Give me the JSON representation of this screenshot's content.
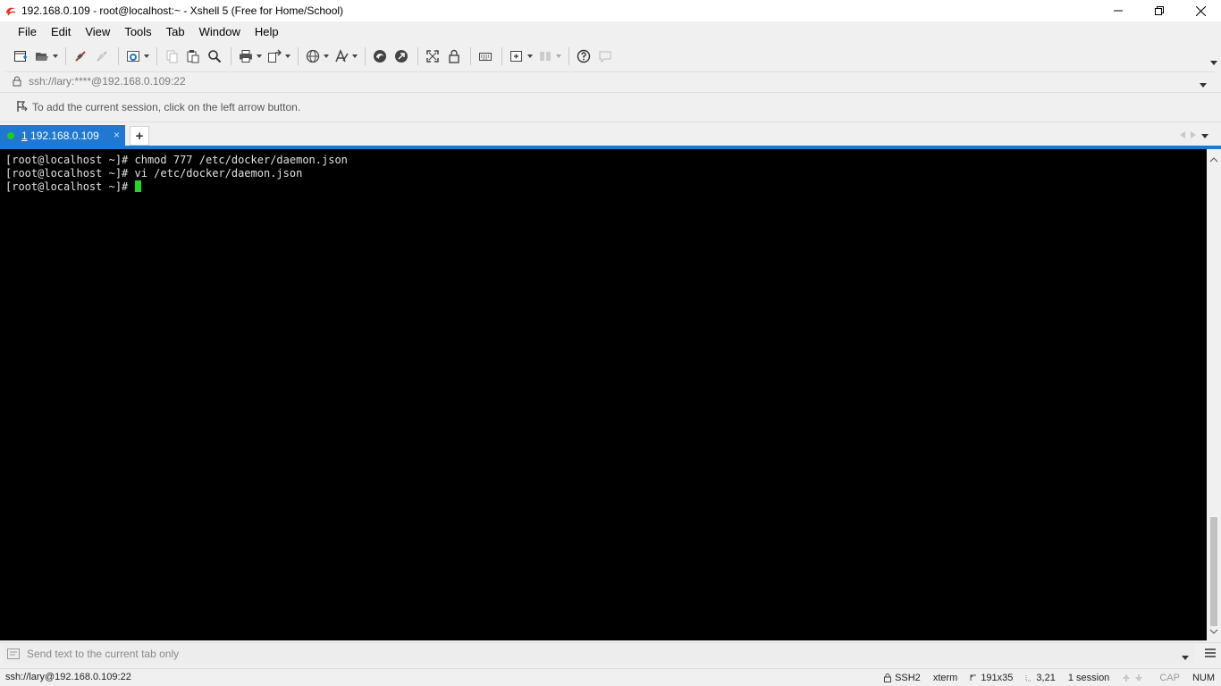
{
  "window": {
    "title": "192.168.0.109 - root@localhost:~ - Xshell 5 (Free for Home/School)"
  },
  "menu": {
    "items": [
      "File",
      "Edit",
      "View",
      "Tools",
      "Tab",
      "Window",
      "Help"
    ]
  },
  "address": {
    "value": "ssh://lary:****@192.168.0.109:22"
  },
  "info": {
    "text": "To add the current session, click on the left arrow button."
  },
  "tabs": {
    "active": {
      "number": "1",
      "label": "192.168.0.109",
      "close": "×"
    },
    "add_label": "+"
  },
  "terminal": {
    "lines": [
      "[root@localhost ~]# chmod 777 /etc/docker/daemon.json",
      "[root@localhost ~]# vi /etc/docker/daemon.json",
      "[root@localhost ~]# "
    ]
  },
  "compose": {
    "placeholder": "Send text to the current tab only"
  },
  "status": {
    "connection": "ssh://lary@192.168.0.109:22",
    "protocol": "SSH2",
    "terminal_type": "xterm",
    "size": "191x35",
    "cursor_pos": "3,21",
    "sessions": "1 session",
    "cap": "CAP",
    "num": "NUM"
  },
  "colors": {
    "accent": "#1f78d1",
    "cursor": "#22d822",
    "terminal_bg": "#000000",
    "connected_dot": "#22c922"
  },
  "icons": {
    "app": "xshell-logo-icon",
    "lock": "lock-icon"
  }
}
